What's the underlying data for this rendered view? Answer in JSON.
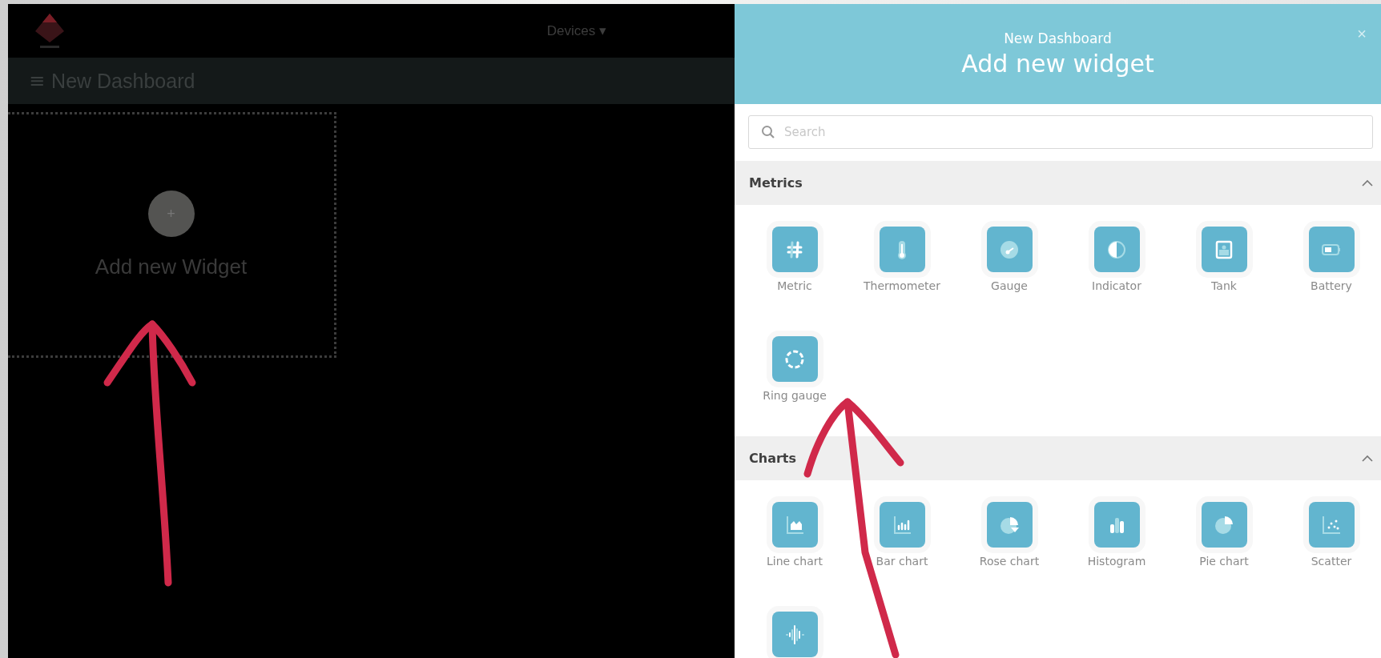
{
  "navbar": {
    "menu": "Devices",
    "menu_caret": "▾"
  },
  "toolbar": {
    "menu_glyph": "≡",
    "title": "New Dashboard"
  },
  "placeholder_card": {
    "plus": "+",
    "label": "Add new Widget"
  },
  "panel": {
    "subtitle": "New Dashboard",
    "title": "Add new widget",
    "close": "×",
    "search": {
      "placeholder": "Search"
    },
    "sections": [
      {
        "title": "Metrics",
        "expanded": true,
        "widgets": [
          {
            "label": "Metric",
            "kind": "metric"
          },
          {
            "label": "Thermometer",
            "kind": "thermometer"
          },
          {
            "label": "Gauge",
            "kind": "gauge"
          },
          {
            "label": "Indicator",
            "kind": "indicator"
          },
          {
            "label": "Tank",
            "kind": "tank"
          },
          {
            "label": "Battery",
            "kind": "battery"
          },
          {
            "label": "Ring gauge",
            "kind": "ring"
          }
        ]
      },
      {
        "title": "Charts",
        "expanded": true,
        "widgets": [
          {
            "label": "Line chart",
            "kind": "line"
          },
          {
            "label": "Bar chart",
            "kind": "bar"
          },
          {
            "label": "Rose chart",
            "kind": "rose"
          },
          {
            "label": "Histogram",
            "kind": "histogram"
          },
          {
            "label": "Pie chart",
            "kind": "pie"
          },
          {
            "label": "Scatter",
            "kind": "scatter"
          },
          {
            "kind": "wave"
          }
        ]
      }
    ]
  }
}
